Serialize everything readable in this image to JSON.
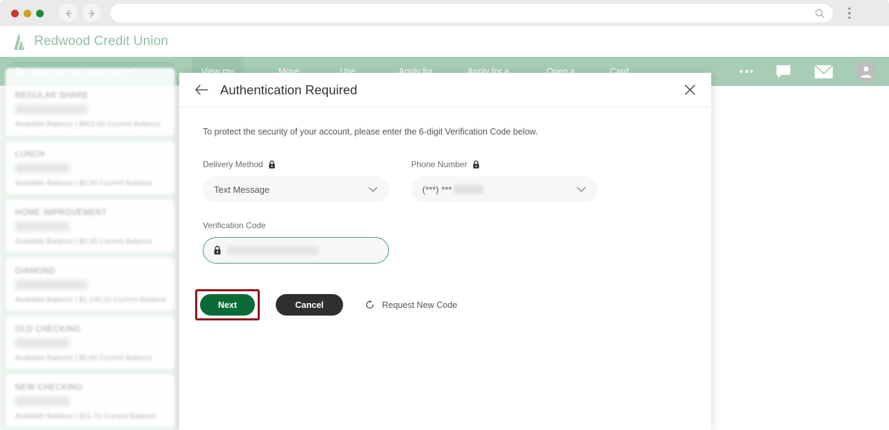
{
  "browser": {
    "url_value": "",
    "back_icon": "back-arrow-icon",
    "forward_icon": "forward-arrow-icon",
    "search_icon": "search-icon",
    "menu_icon": "kebab-menu-icon"
  },
  "site": {
    "brand": "Redwood Credit Union",
    "logo_icon": "redwood-tree-logo"
  },
  "nav": {
    "search_placeholder": "What are you looking for?",
    "search_icon": "search-icon",
    "items": [
      {
        "label": "View my",
        "active": true
      },
      {
        "label": "Move",
        "active": false
      },
      {
        "label": "Use",
        "active": false
      },
      {
        "label": "Apply for",
        "active": false
      },
      {
        "label": "Apply for a",
        "active": false
      },
      {
        "label": "Open a",
        "active": false
      },
      {
        "label": "Card",
        "active": false
      }
    ],
    "more_icon": "more-dots-icon",
    "chat_icon": "chat-bubble-icon",
    "mail_icon": "envelope-icon",
    "profile_icon": "user-avatar-icon"
  },
  "sidebar": {
    "accounts": [
      {
        "name": "REGULAR SHARE",
        "balance": "Available Balance  |  $902.60 Current Balance"
      },
      {
        "name": "LUNCH",
        "balance": "Available Balance  |  $0.00 Current Balance"
      },
      {
        "name": "HOME IMPROVEMENT",
        "balance": "Available Balance  |  $0.00 Current Balance"
      },
      {
        "name": "DIAMOND",
        "balance": "Available Balance  |  $1,140.22 Current Balance"
      },
      {
        "name": "OLD CHECKING",
        "balance": "Available Balance  |  $0.00 Current Balance"
      },
      {
        "name": "NEW CHECKING",
        "balance": "Available Balance  |  $21.72 Current Balance"
      }
    ]
  },
  "modal": {
    "title": "Authentication Required",
    "back_icon": "back-arrow-icon",
    "close_icon": "close-x-icon",
    "description": "To protect the security of your account, please enter the 6-digit Verification Code below.",
    "delivery_method": {
      "label": "Delivery Method",
      "lock_icon": "lock-icon",
      "value": "Text Message",
      "chevron_icon": "chevron-down-icon",
      "options": [
        "Text Message"
      ]
    },
    "phone_number": {
      "label": "Phone Number",
      "lock_icon": "lock-icon",
      "value": "(***) ***",
      "chevron_icon": "chevron-down-icon"
    },
    "verification_code": {
      "label": "Verification Code",
      "lock_icon": "lock-icon",
      "value": ""
    },
    "buttons": {
      "next": "Next",
      "cancel": "Cancel",
      "request_new_code": "Request New Code",
      "refresh_icon": "refresh-icon"
    }
  },
  "colors": {
    "brand_green": "#a8cdb6",
    "logo_green": "#8fbfa4",
    "primary_button": "#0a6b38",
    "cancel_button": "#2f2f2f",
    "focus_border": "#3e9b6b",
    "highlight_box": "#8c1616"
  }
}
